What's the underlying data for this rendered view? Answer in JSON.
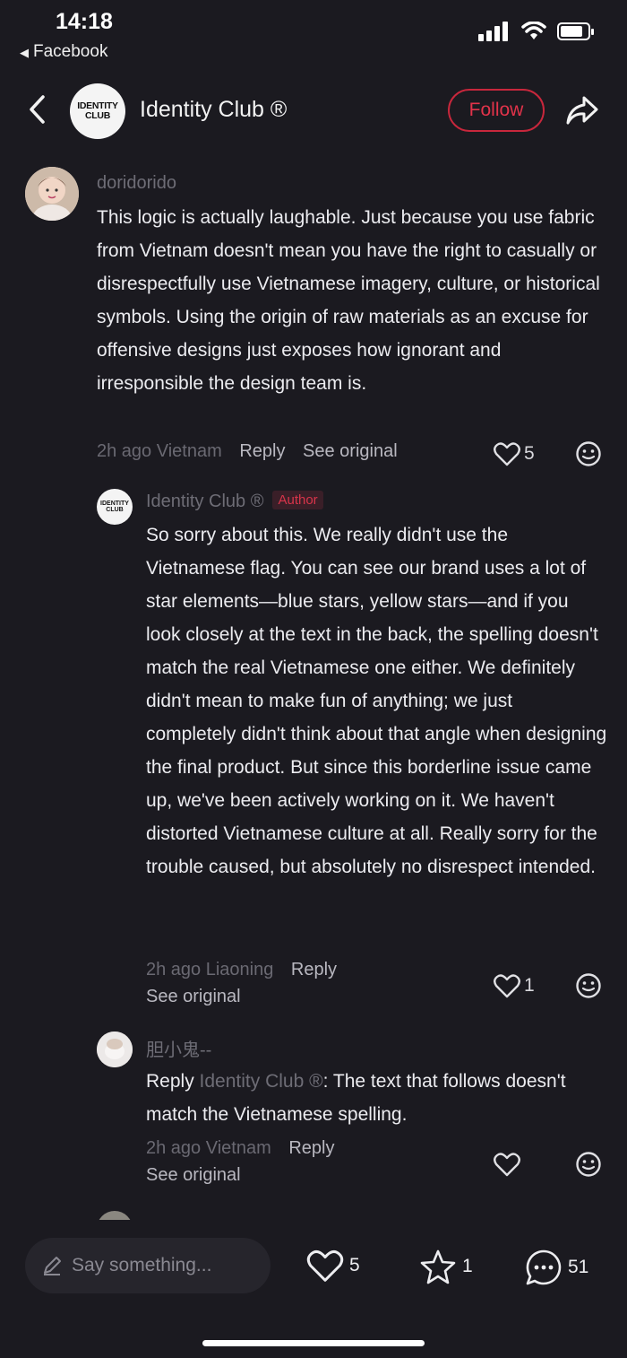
{
  "status_bar": {
    "time": "14:18",
    "back_app": "Facebook",
    "icons": [
      "signal-icon",
      "wifi-icon",
      "battery-icon"
    ]
  },
  "header": {
    "logo_text": [
      "IDENTITY",
      "CLUB"
    ],
    "title": "Identity Club ®",
    "follow_label": "Follow",
    "icons": [
      "back-chevron-icon",
      "share-icon"
    ],
    "accent_color": "#e2334a"
  },
  "comments": [
    {
      "username": "doridorido",
      "text": "This logic is actually laughable. Just because you use fabric from Vietnam doesn't mean you have the right to casually or disrespectfully use Vietnamese imagery, culture, or historical symbols. Using the origin of raw materials as an excuse for offensive designs just exposes how ignorant and irresponsible the design team is.",
      "time": "2h ago",
      "location": "Vietnam",
      "reply_label": "Reply",
      "see_original_label": "See original",
      "likes": "5"
    },
    {
      "username": "Identity Club ®",
      "badge": "Author",
      "text": "So sorry about this. We really didn't use the Vietnamese flag. You can see our brand uses a lot of star elements—blue stars, yellow stars—and if you look closely at the text in the back, the spelling doesn't match the real Vietnamese one either. We definitely didn't mean to make fun of anything; we just completely didn't think about that angle when designing the final product. But since this borderline issue came up, we've been actively working on it. We haven't distorted Vietnamese culture at all. Really sorry for the trouble caused, but absolutely no disrespect intended.",
      "time": "2h ago",
      "location": "Liaoning",
      "reply_label": "Reply",
      "see_original_label": "See original",
      "likes": "1"
    },
    {
      "username": "胆小鬼--",
      "reply_prefix": "Reply",
      "mention": "Identity Club ®",
      "text": ": The text that follows doesn't match the Vietnamese spelling.",
      "time": "2h ago",
      "location": "Vietnam",
      "reply_label": "Reply",
      "see_original_label": "See original",
      "likes": ""
    }
  ],
  "bottom_bar": {
    "placeholder": "Say something...",
    "likes": "5",
    "stars": "1",
    "comments": "51"
  }
}
